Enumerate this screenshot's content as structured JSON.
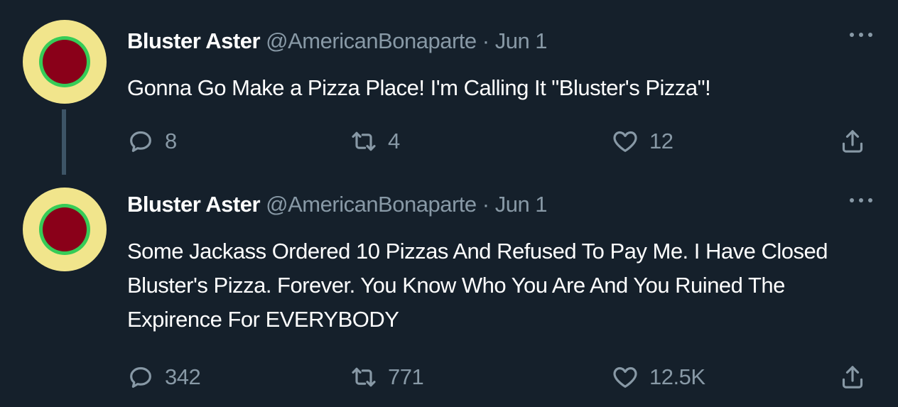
{
  "tweets": [
    {
      "author_name": "Bluster Aster",
      "handle": "@AmericanBonaparte",
      "separator": "·",
      "date": "Jun 1",
      "text": "Gonna Go Make a Pizza Place! I'm Calling It \"Bluster's Pizza\"!",
      "reply_count": "8",
      "retweet_count": "4",
      "like_count": "12"
    },
    {
      "author_name": "Bluster Aster",
      "handle": "@AmericanBonaparte",
      "separator": "·",
      "date": "Jun 1",
      "text": "Some Jackass Ordered 10 Pizzas And Refused To Pay Me. I Have Closed Bluster's Pizza. Forever. You Know Who You Are And You Ruined The Expirence For EVERYBODY",
      "reply_count": "342",
      "retweet_count": "771",
      "like_count": "12.5K"
    }
  ],
  "icons": {
    "reply": "reply-icon",
    "retweet": "retweet-icon",
    "like": "heart-icon",
    "share": "share-icon",
    "more": "more-icon"
  },
  "colors": {
    "background": "#15202b",
    "text": "#ffffff",
    "secondary": "#8899a6",
    "thread_line": "#3d5466",
    "avatar_outer": "#f1e58c",
    "avatar_ring": "#36cc57",
    "avatar_core": "#8a0019"
  }
}
